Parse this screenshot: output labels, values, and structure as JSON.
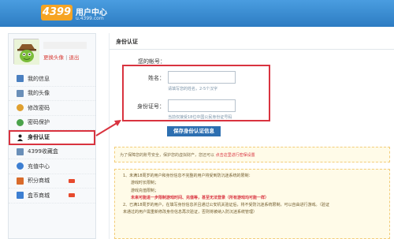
{
  "header": {
    "logo": "4399",
    "title": "用户中心",
    "url": "u.4399.com"
  },
  "user": {
    "change_avatar": "更换头像",
    "separator": "|",
    "logout": "退出"
  },
  "nav": {
    "items": [
      {
        "label": "我的信息",
        "icon": "user-info-icon",
        "color": "#4a7fc0"
      },
      {
        "label": "我的头像",
        "icon": "avatar-icon",
        "color": "#6a8fb8"
      },
      {
        "label": "修改密码",
        "icon": "key-icon",
        "color": "#e0a030"
      },
      {
        "label": "密码保护",
        "icon": "shield-icon",
        "color": "#4ba34b"
      },
      {
        "label": "身份认证",
        "icon": "person-icon",
        "color": "#222222"
      },
      {
        "label": "4399收藏盒",
        "icon": "box-icon",
        "color": "#6a8fb8"
      },
      {
        "label": "充值中心",
        "icon": "coin-icon",
        "color": "#3d7fd2"
      },
      {
        "label": "积分商城",
        "icon": "points-icon",
        "color": "#d96b2b"
      },
      {
        "label": "盒币商城",
        "icon": "boxcoin-icon",
        "color": "#3d7fd2"
      }
    ]
  },
  "content": {
    "breadcrumb": "身份认证",
    "account_label": "您的帐号：",
    "name_label": "姓名：",
    "name_hint": "请填写您的姓名，2-5个汉字",
    "id_label": "身份证号：",
    "id_hint": "当前仅接受18位中国公民身份证号码",
    "save_button": "保存身份认证信息",
    "notice1_text": "为了保障您的账号安全，保护您的虚拟财产，您还可以 ",
    "notice1_link": "点击这里进行密保设置",
    "notice2": {
      "line1": "1、未满18周岁的用户和身份信息不完整的用户将受到防沉迷系统的限制：",
      "line2": "游戏时长限制；",
      "line3": "游戏充值限制；",
      "line4": "未来可能进一步限制游戏时间、充值等，甚至无法登录（所有游戏均可能一样）",
      "line5": "2、已满18周岁的用户，在填写身份信息并且通过公安机关验证后，将不受防沉迷系统限制，可以自由进行游戏。（验证",
      "line6": "未通过的用户需重新修改身份信息再次验证，否则将被纳入防沉迷系统管理）"
    }
  }
}
